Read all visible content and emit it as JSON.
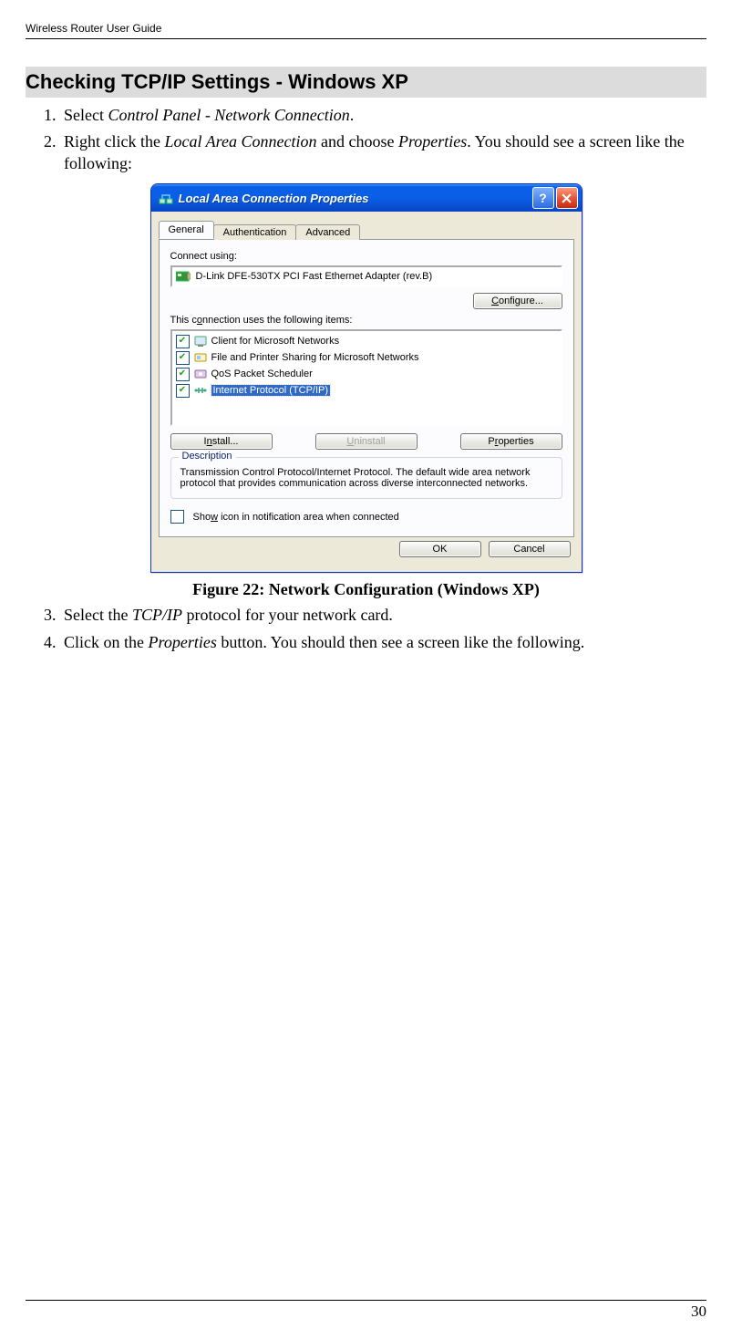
{
  "header": {
    "running": "Wireless Router User Guide"
  },
  "section": {
    "heading": "Checking TCP/IP Settings - Windows XP"
  },
  "steps": {
    "s1_a": "Select ",
    "s1_i": "Control Panel - Network Connection",
    "s1_b": ".",
    "s2_a": "Right click the ",
    "s2_i1": "Local Area Connection",
    "s2_b": " and choose ",
    "s2_i2": "Properties",
    "s2_c": ". You should see a screen like the following:",
    "s3_a": "Select the ",
    "s3_i": "TCP/IP",
    "s3_b": " protocol for your network card.",
    "s4_a": "Click on the ",
    "s4_i": "Properties",
    "s4_b": " button. You should then see a screen like the following."
  },
  "figure": {
    "caption": "Figure 22: Network Configuration (Windows  XP)"
  },
  "dialog": {
    "title": "Local Area Connection Properties",
    "tabs": [
      "General",
      "Authentication",
      "Advanced"
    ],
    "connectUsingLabel": "Connect using:",
    "adapter": "D-Link DFE-530TX PCI Fast Ethernet Adapter (rev.B)",
    "configureBtn": "Configure...",
    "itemsLabel": "This connection uses the following items:",
    "items": [
      {
        "label": "Client for Microsoft Networks",
        "checked": true,
        "selected": false
      },
      {
        "label": "File and Printer Sharing for Microsoft Networks",
        "checked": true,
        "selected": false
      },
      {
        "label": "QoS Packet Scheduler",
        "checked": true,
        "selected": false
      },
      {
        "label": "Internet Protocol (TCP/IP)",
        "checked": true,
        "selected": true
      }
    ],
    "installBtn": "Install...",
    "uninstallBtn": "Uninstall",
    "propertiesBtn": "Properties",
    "descLegend": "Description",
    "descText": "Transmission Control Protocol/Internet Protocol. The default wide area network protocol that provides communication across diverse interconnected networks.",
    "showIconLabel": "Show icon in notification area when connected",
    "okBtn": "OK",
    "cancelBtn": "Cancel"
  },
  "footer": {
    "page": "30"
  }
}
